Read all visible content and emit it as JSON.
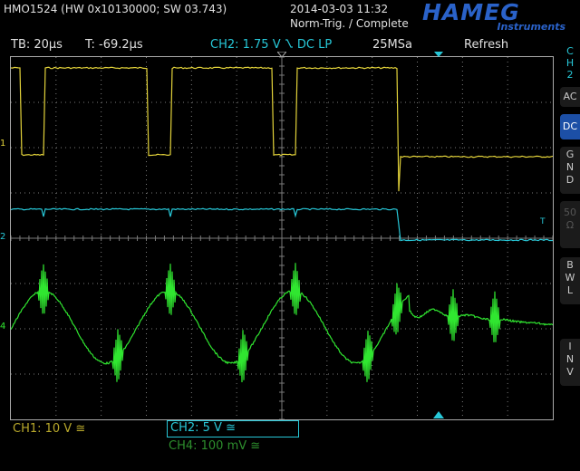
{
  "header": {
    "device": "HMO1524 (HW 0x10130000; SW 03.743)",
    "datetime": "2014-03-03 11:32",
    "trigger": "Norm-Trig. / Complete",
    "logo": "HAMEG",
    "logo_sub": "Instruments"
  },
  "info": {
    "timebase": "TB: 20µs",
    "trigger_time": "T: -69.2µs",
    "trigger_ch": "CH2: 1.75 V",
    "trigger_slope_icon": "falling-edge-icon",
    "coupling": "DC LP",
    "sample_rate": "25MSa",
    "mode": "Refresh"
  },
  "side_menu": {
    "channel": [
      "C",
      "H",
      "2"
    ],
    "buttons": [
      {
        "letters": [
          "AC"
        ],
        "active": false,
        "dim": false
      },
      {
        "letters": [
          "DC"
        ],
        "active": true,
        "dim": false
      },
      {
        "letters": [
          "G",
          "N",
          "D"
        ],
        "active": false,
        "dim": false
      },
      {
        "letters": [
          "50",
          "Ω"
        ],
        "active": false,
        "dim": true
      },
      {
        "letters": [
          "B",
          "W",
          "L"
        ],
        "active": false,
        "dim": false
      },
      {
        "letters": [
          "I",
          "N",
          "V"
        ],
        "active": false,
        "dim": false
      }
    ]
  },
  "markers": {
    "ch1": "1",
    "ch2": "2",
    "ch4": "4",
    "trigger_level": "T"
  },
  "bottom": {
    "ch1": "CH1: 10 V ≅",
    "ch2": "CH2: 5 V ≅",
    "ch4": "CH4: 100 mV ≅"
  },
  "colors": {
    "ch1": "#e2d23a",
    "ch2": "#27c8d8",
    "ch4": "#30e630",
    "grid": "#7a7a7a",
    "accent": "#1c4fa6"
  }
}
